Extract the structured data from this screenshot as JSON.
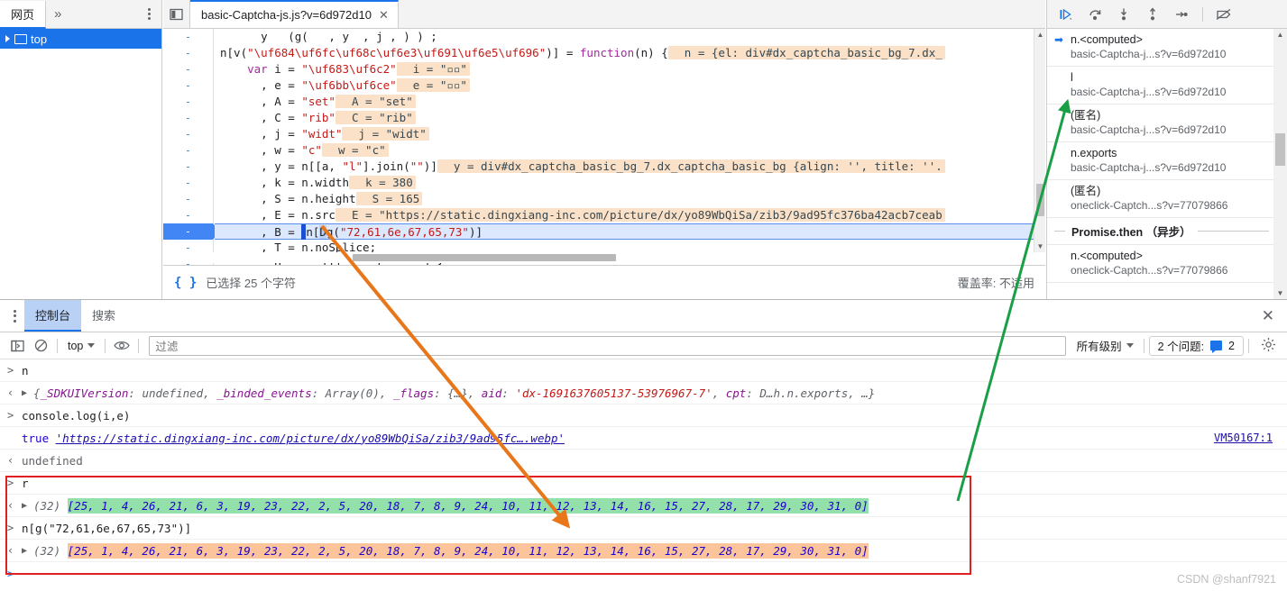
{
  "navigator": {
    "tabs": [
      {
        "label": "网页"
      }
    ],
    "more_label": "»",
    "menu_icon": "more-vertical-icon",
    "tree": [
      {
        "label": "top",
        "icon": "window-icon",
        "selected": true
      }
    ]
  },
  "editor": {
    "sidebar_toggle_icon": "panel-collapse-icon",
    "tab": {
      "label": "basic-Captcha-js.js?v=6d972d10",
      "close_icon": "close-icon"
    },
    "gutter_marks": [
      "-",
      "-",
      "-",
      "-",
      "-",
      "-",
      "-",
      "-",
      "-",
      "-",
      "-",
      "-",
      "-",
      "-"
    ],
    "active_line_index": 11,
    "lines": [
      {
        "segments": [
          {
            "t": "      y   (g(   , y  , j , ) ) ;",
            "c": "pun"
          }
        ],
        "clipped": true
      },
      {
        "segments": [
          {
            "t": "n[v(",
            "c": "pun"
          },
          {
            "t": "\"\\uf684\\uf6fc\\uf68c\\uf6e3\\uf691\\uf6e5\\uf696\"",
            "c": "str"
          },
          {
            "t": ")] = ",
            "c": "pun"
          },
          {
            "t": "function",
            "c": "kw"
          },
          {
            "t": "(n) {",
            "c": "pun"
          }
        ],
        "hint": "n = {el: div#dx_captcha_basic_bg_7.dx_"
      },
      {
        "segments": [
          {
            "t": "    ",
            "c": "pun"
          },
          {
            "t": "var",
            "c": "kw"
          },
          {
            "t": " i = ",
            "c": "pun"
          },
          {
            "t": "\"\\uf683\\uf6c2\"",
            "c": "str"
          }
        ],
        "hint": "i = \"▫▫\""
      },
      {
        "segments": [
          {
            "t": "      , e = ",
            "c": "pun"
          },
          {
            "t": "\"\\uf6bb\\uf6ce\"",
            "c": "str"
          }
        ],
        "hint": "e = \"▫▫\""
      },
      {
        "segments": [
          {
            "t": "      , A = ",
            "c": "pun"
          },
          {
            "t": "\"set\"",
            "c": "str"
          }
        ],
        "hint": "A = \"set\""
      },
      {
        "segments": [
          {
            "t": "      , C = ",
            "c": "pun"
          },
          {
            "t": "\"rib\"",
            "c": "str"
          }
        ],
        "hint": "C = \"rib\""
      },
      {
        "segments": [
          {
            "t": "      , j = ",
            "c": "pun"
          },
          {
            "t": "\"widt\"",
            "c": "str"
          }
        ],
        "hint": "j = \"widt\""
      },
      {
        "segments": [
          {
            "t": "      , w = ",
            "c": "pun"
          },
          {
            "t": "\"c\"",
            "c": "str"
          }
        ],
        "hint": "w = \"c\""
      },
      {
        "segments": [
          {
            "t": "      , y = n[[a, ",
            "c": "pun"
          },
          {
            "t": "\"l\"",
            "c": "str"
          },
          {
            "t": "].join(",
            "c": "pun"
          },
          {
            "t": "\"\"",
            "c": "str"
          },
          {
            "t": ")]",
            "c": "pun"
          }
        ],
        "hint": "y = div#dx_captcha_basic_bg_7.dx_captcha_basic_bg {align: '', title: ''."
      },
      {
        "segments": [
          {
            "t": "      , k = n.width",
            "c": "pun"
          }
        ],
        "hint": "k = 380"
      },
      {
        "segments": [
          {
            "t": "      , S = n.height",
            "c": "pun"
          }
        ],
        "hint": "S = 165"
      },
      {
        "segments": [
          {
            "t": "      , E = n.src",
            "c": "pun"
          }
        ],
        "hint": "E = \"https://static.dingxiang-inc.com/picture/dx/yo89WbQiSa/zib3/9ad95fc376ba42acb7ceab"
      },
      {
        "segments": [
          {
            "t": "      , B = ",
            "c": "pun"
          },
          {
            "t": "cursor",
            "c": "cursor"
          },
          {
            "t": "n[",
            "c": "pun"
          },
          {
            "t": "D",
            "c": "sel"
          },
          {
            "t": "g(",
            "c": "pun"
          },
          {
            "t": "\"72,61,6e,67,65,73\"",
            "c": "str"
          },
          {
            "t": ")]",
            "c": "pun"
          }
        ],
        "active": true
      },
      {
        "segments": [
          {
            "t": "      , T = n.noSplice;",
            "c": "pun"
          }
        ]
      },
      {
        "segments": [
          {
            "t": "        D      ((f     (      ) {",
            "c": "pun"
          }
        ],
        "clipped": true
      }
    ],
    "status": {
      "braces_icon": "format-braces-icon",
      "selection_text": "已选择 25 个字符",
      "coverage_text": "覆盖率: 不适用"
    }
  },
  "debugger": {
    "toolbar": [
      {
        "name": "resume-script-button",
        "icon": "resume-icon"
      },
      {
        "name": "step-over-button",
        "icon": "step-over-icon"
      },
      {
        "name": "step-into-button",
        "icon": "step-into-icon"
      },
      {
        "name": "step-out-button",
        "icon": "step-out-icon"
      },
      {
        "name": "step-button",
        "icon": "step-icon"
      },
      {
        "name": "deactivate-breakpoints-button",
        "icon": "breakpoint-off-icon"
      }
    ],
    "call_stack": [
      {
        "name": "n.<computed>",
        "url": "basic-Captcha-j...s?v=6d972d10",
        "selected": true
      },
      {
        "name": "l",
        "url": "basic-Captcha-j...s?v=6d972d10",
        "selected": false
      },
      {
        "name": "(匿名)",
        "url": "basic-Captcha-j...s?v=6d972d10",
        "selected": false
      },
      {
        "name": "n.exports",
        "url": "basic-Captcha-j...s?v=6d972d10",
        "selected": false
      },
      {
        "name": "(匿名)",
        "url": "oneclick-Captch...s?v=77079866",
        "selected": false
      },
      {
        "async_label": "Promise.then （异步）"
      },
      {
        "name": "n.<computed>",
        "url": "oneclick-Captch...s?v=77079866",
        "selected": false
      }
    ]
  },
  "drawer": {
    "menu_icon": "more-vertical-icon",
    "tabs": [
      {
        "label": "控制台",
        "selected": true
      },
      {
        "label": "搜索",
        "selected": false
      }
    ],
    "close_icon": "close-icon",
    "console_toolbar": {
      "sidebar_icon": "console-sidebar-icon",
      "clear_icon": "clear-console-icon",
      "context_value": "top",
      "eye_icon": "live-expression-icon",
      "filter_placeholder": "过滤",
      "filter_value": "",
      "level_value": "所有级别",
      "issues_text": "2 个问题:",
      "issues_count": "2",
      "issues_icon": "issue-icon",
      "settings_icon": "gear-icon"
    }
  },
  "console": {
    "messages": [
      {
        "kind": "input",
        "text": "n"
      },
      {
        "kind": "object",
        "preview_parts": [
          {
            "t": "{",
            "c": "obj-prev"
          },
          {
            "t": "_SDKUIVersion",
            "c": "obj-key"
          },
          {
            "t": ": ",
            "c": "obj-prev"
          },
          {
            "t": "undefined",
            "c": "obj-prev"
          },
          {
            "t": ", ",
            "c": "obj-prev"
          },
          {
            "t": "_binded_events",
            "c": "obj-key"
          },
          {
            "t": ": ",
            "c": "obj-prev"
          },
          {
            "t": "Array(0)",
            "c": "obj-prev"
          },
          {
            "t": ", ",
            "c": "obj-prev"
          },
          {
            "t": "_flags",
            "c": "obj-key"
          },
          {
            "t": ": ",
            "c": "obj-prev"
          },
          {
            "t": "{…}",
            "c": "obj-prev"
          },
          {
            "t": ", ",
            "c": "obj-prev"
          },
          {
            "t": "aid",
            "c": "obj-key"
          },
          {
            "t": ": ",
            "c": "obj-prev"
          },
          {
            "t": "'dx-1691637605137-53976967-7'",
            "c": "obj-str"
          },
          {
            "t": ", ",
            "c": "obj-prev"
          },
          {
            "t": "cpt",
            "c": "obj-key"
          },
          {
            "t": ": ",
            "c": "obj-prev"
          },
          {
            "t": "D…h.n.exports",
            "c": "obj-prev"
          },
          {
            "t": ", …}",
            "c": "obj-prev"
          }
        ]
      },
      {
        "kind": "input",
        "text": "console.log(i,e)"
      },
      {
        "kind": "log",
        "value_true": "true",
        "url": "'https://static.dingxiang-inc.com/picture/dx/yo89WbQiSa/zib3/9ad95fc….webp'",
        "source_link": "VM50167:1"
      },
      {
        "kind": "result",
        "text": "undefined"
      },
      {
        "kind": "input",
        "text": "r"
      },
      {
        "kind": "array",
        "count": "(32)",
        "highlight": "green",
        "values": [
          25,
          1,
          4,
          26,
          21,
          6,
          3,
          19,
          23,
          22,
          2,
          5,
          20,
          18,
          7,
          8,
          9,
          24,
          10,
          11,
          12,
          13,
          14,
          16,
          15,
          27,
          28,
          17,
          29,
          30,
          31,
          0
        ]
      },
      {
        "kind": "input",
        "text": "n[g(\"72,61,6e,67,65,73\")]"
      },
      {
        "kind": "array",
        "count": "(32)",
        "highlight": "orange",
        "values": [
          25,
          1,
          4,
          26,
          21,
          6,
          3,
          19,
          23,
          22,
          2,
          5,
          20,
          18,
          7,
          8,
          9,
          24,
          10,
          11,
          12,
          13,
          14,
          16,
          15,
          27,
          28,
          17,
          29,
          30,
          31,
          0
        ]
      }
    ],
    "prompt_symbol": ">"
  },
  "annotations": {
    "red_box": {
      "color": "#e02020"
    },
    "orange_arrow": {
      "color": "#e8761a"
    },
    "green_arrow": {
      "color": "#1a9e46"
    }
  },
  "watermark": "CSDN @shanf7921"
}
